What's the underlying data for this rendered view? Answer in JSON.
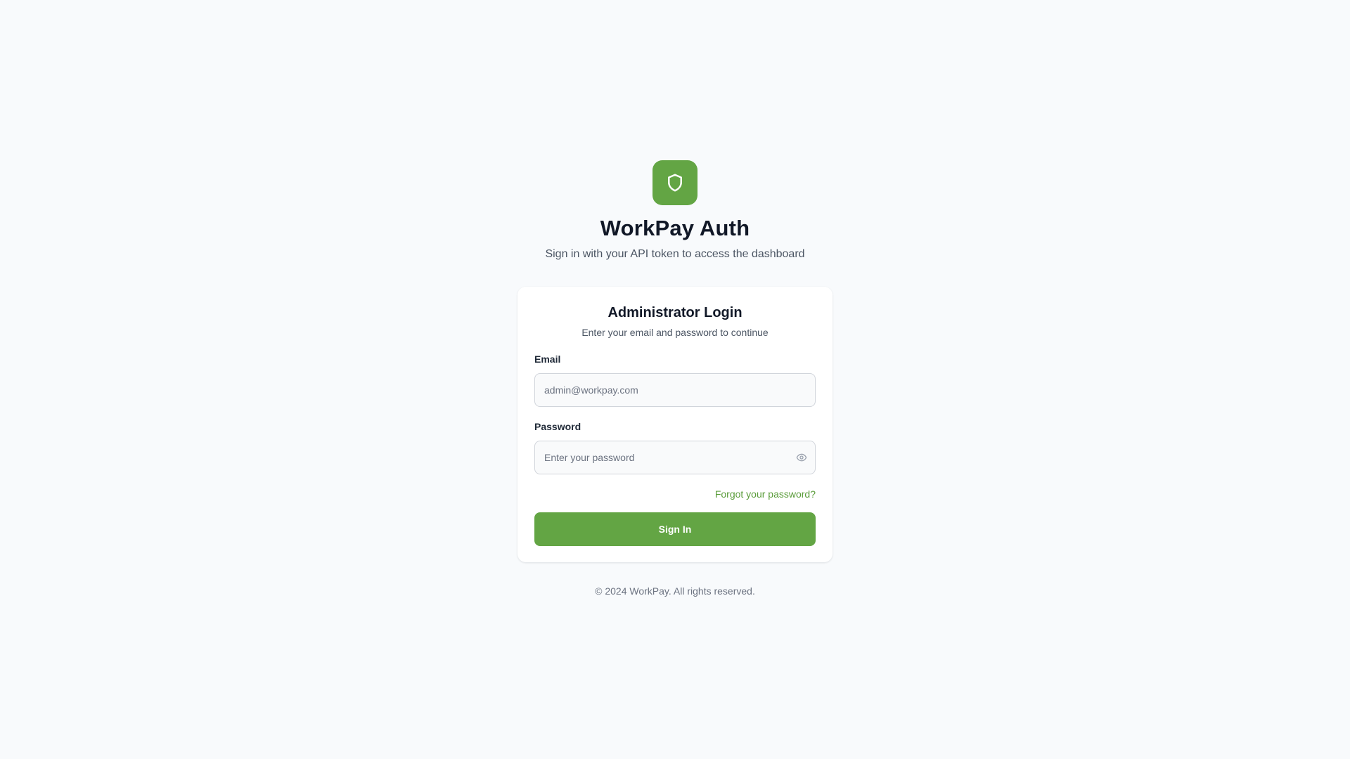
{
  "brand": {
    "title": "WorkPay Auth",
    "subtitle": "Sign in with your API token to access the dashboard",
    "logo_icon": "shield-icon",
    "accent_color": "#63a544"
  },
  "login_card": {
    "title": "Administrator Login",
    "subtitle": "Enter your email and password to continue",
    "email": {
      "label": "Email",
      "value": "",
      "placeholder": "admin@workpay.com"
    },
    "password": {
      "label": "Password",
      "value": "",
      "placeholder": "Enter your password",
      "toggle_icon": "eye-icon"
    },
    "forgot_password_label": "Forgot your password?",
    "sign_in_label": "Sign In"
  },
  "footer": {
    "copyright": "© 2024 WorkPay. All rights reserved."
  }
}
